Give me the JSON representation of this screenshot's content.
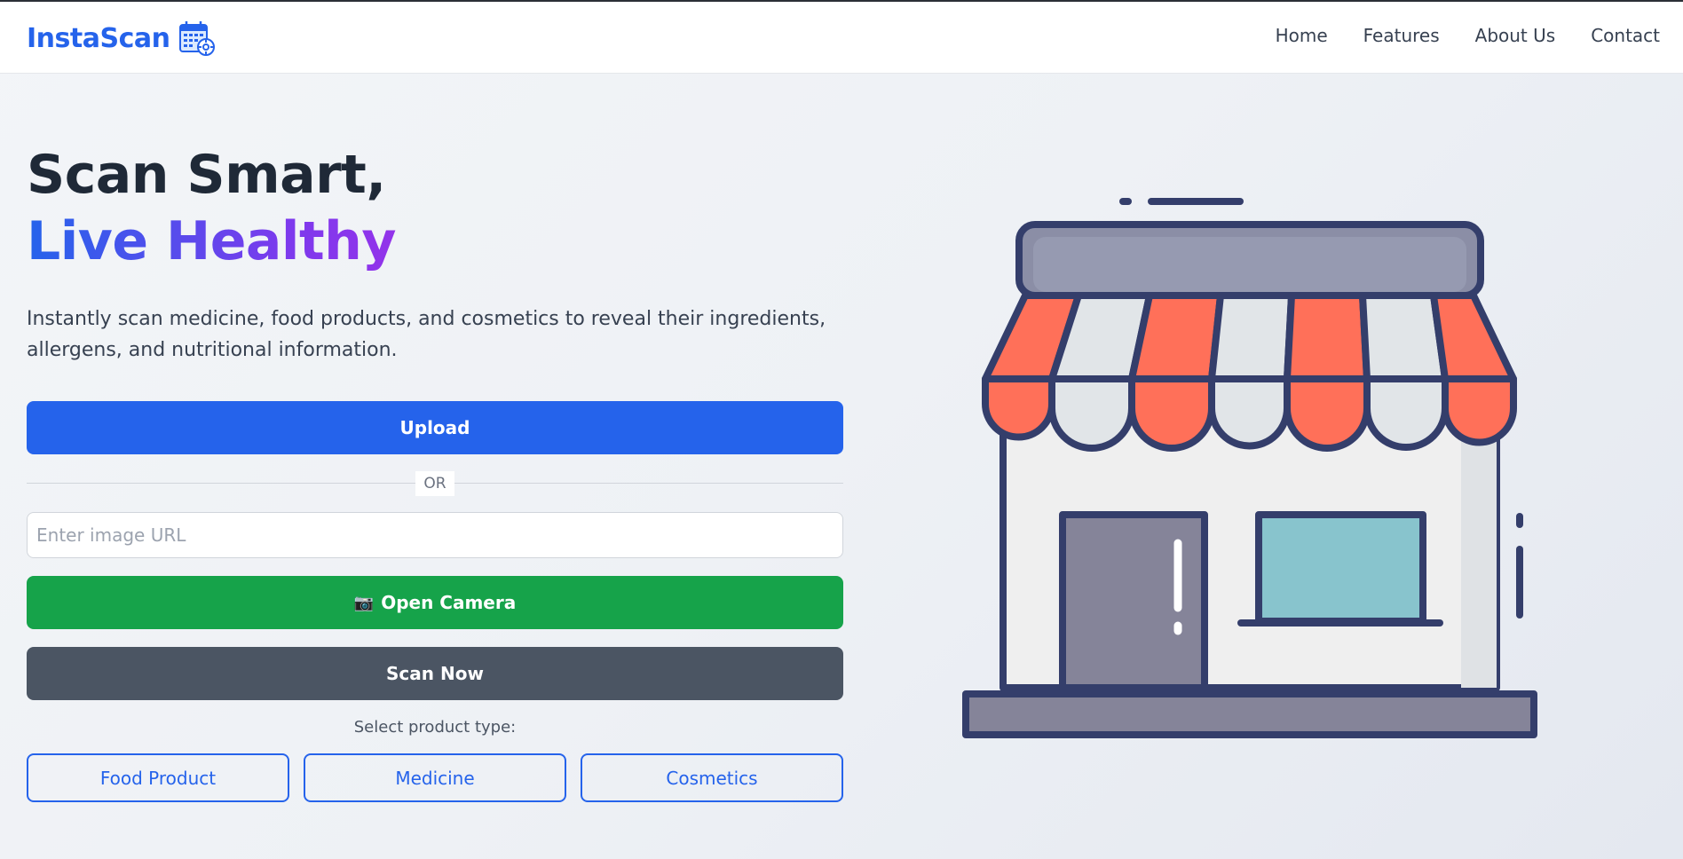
{
  "header": {
    "brand": "InstaScan",
    "brand_icon": "calendar-gear-icon",
    "nav": [
      "Home",
      "Features",
      "About Us",
      "Contact"
    ]
  },
  "hero": {
    "title_line1": "Scan Smart,",
    "title_line2": "Live Healthy",
    "description": "Instantly scan medicine, food products, and cosmetics to reveal their ingredients, allergens, and nutritional information."
  },
  "actions": {
    "upload_label": "Upload",
    "or_label": "OR",
    "url_placeholder": "Enter image URL",
    "url_value": "",
    "camera_icon": "📷",
    "camera_label": "Open Camera",
    "scan_label": "Scan Now"
  },
  "product_type": {
    "label": "Select product type:",
    "options": [
      "Food Product",
      "Medicine",
      "Cosmetics"
    ]
  },
  "illustration": {
    "icon": "storefront-icon"
  },
  "colors": {
    "primary": "#2563eb",
    "success": "#16a34a",
    "neutral": "#4b5563",
    "gradient_end": "#9333ea",
    "awning_red": "#ff7059",
    "outline": "#343e6b"
  }
}
